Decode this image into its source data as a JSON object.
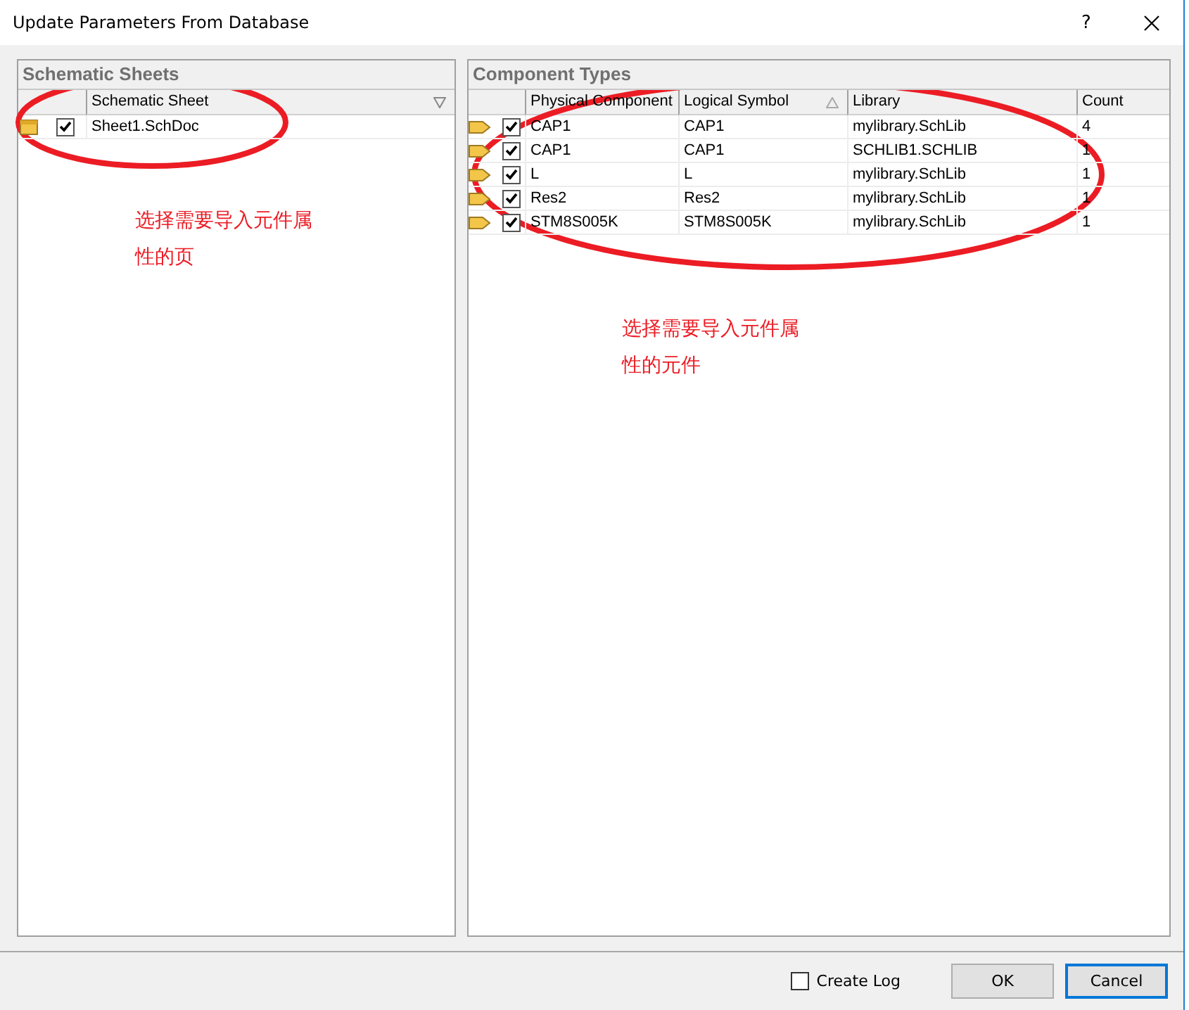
{
  "window": {
    "title": "Update Parameters From Database",
    "help": "?"
  },
  "sheets_panel": {
    "title": "Schematic Sheets",
    "columns": [
      "Schematic Sheet"
    ],
    "rows": [
      {
        "name": "Sheet1.SchDoc",
        "checked": true
      }
    ]
  },
  "components_panel": {
    "title": "Component Types",
    "columns": [
      "Physical Component",
      "Logical Symbol",
      "Library",
      "Count"
    ],
    "rows": [
      {
        "physical": "CAP1",
        "logical": "CAP1",
        "library": "mylibrary.SchLib",
        "count": "4",
        "checked": true
      },
      {
        "physical": "CAP1",
        "logical": "CAP1",
        "library": "SCHLIB1.SCHLIB",
        "count": "1",
        "checked": true
      },
      {
        "physical": "L",
        "logical": "L",
        "library": "mylibrary.SchLib",
        "count": "1",
        "checked": true
      },
      {
        "physical": "Res2",
        "logical": "Res2",
        "library": "mylibrary.SchLib",
        "count": "1",
        "checked": true
      },
      {
        "physical": "STM8S005K",
        "logical": "STM8S005K",
        "library": "mylibrary.SchLib",
        "count": "1",
        "checked": true
      }
    ]
  },
  "annotations": [
    {
      "kind": "ellipse"
    },
    {
      "kind": "ellipse"
    },
    {
      "kind": "note",
      "lines": [
        "选择需要导入元件属",
        "性的页"
      ]
    },
    {
      "kind": "note",
      "lines": [
        "选择需要导入元件属",
        "性的元件"
      ]
    }
  ],
  "footer": {
    "create_log": {
      "label": "Create Log",
      "checked": false
    },
    "buttons": [
      {
        "label": "OK",
        "focused": false
      },
      {
        "label": "Cancel",
        "focused": true
      }
    ]
  }
}
